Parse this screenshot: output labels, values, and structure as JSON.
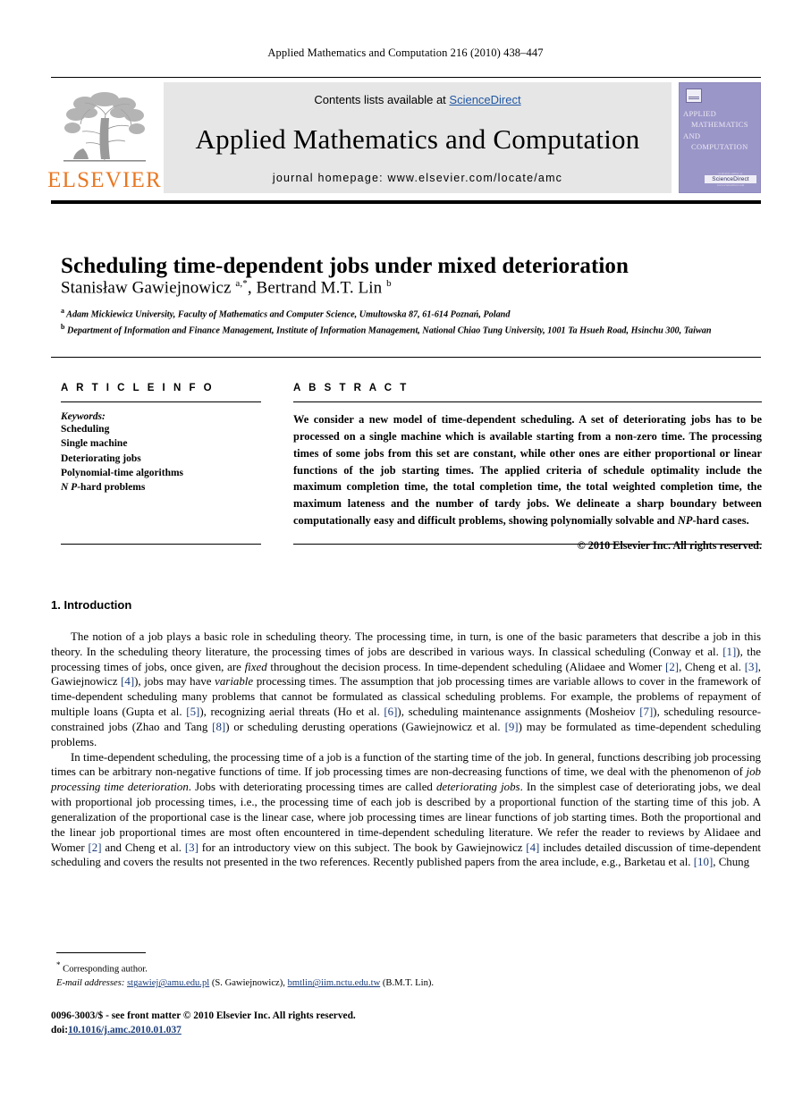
{
  "running_head": "Applied Mathematics and Computation 216 (2010) 438–447",
  "masthead": {
    "publisher_name": "ELSEVIER",
    "contents_prefix": "Contents lists available at ",
    "contents_link": "ScienceDirect",
    "journal_title": "Applied Mathematics and Computation",
    "homepage_line": "journal homepage: www.elsevier.com/locate/amc",
    "cover": {
      "line1": "APPLIED",
      "line2": "MATHEMATICS",
      "line3": "AND",
      "line4": "COMPUTATION",
      "badge_top": "available online at",
      "badge_mid": "ScienceDirect",
      "badge_bottom": "www.sciencedirect.com"
    }
  },
  "article": {
    "title": "Scheduling time-dependent jobs under mixed deterioration",
    "authors": "Stanisław Gawiejnowicz <sup>a,*</sup>, Bertrand M.T. Lin <sup>b</sup>",
    "affiliation_a": "<sup>a</sup> Adam Mickiewicz University, Faculty of Mathematics and Computer Science, Umultowska 87, 61-614 Poznań, Poland",
    "affiliation_b": "<sup>b</sup> Department of Information and Finance Management, Institute of Information Management, National Chiao Tung University, 1001 Ta Hsueh Road, Hsinchu 300, Taiwan"
  },
  "article_info": {
    "heading": "A R T I C L E   I N F O",
    "keywords_label": "Keywords:",
    "keywords": [
      "Scheduling",
      "Single machine",
      "Deteriorating jobs",
      "Polynomial-time algorithms",
      "NP-hard problems"
    ]
  },
  "abstract": {
    "heading": "A B S T R A C T",
    "text": "We consider a new model of time-dependent scheduling. A set of deteriorating jobs has to be processed on a single machine which is available starting from a non-zero time. The processing times of some jobs from this set are constant, while other ones are either proportional or linear functions of the job starting times. The applied criteria of schedule optimality include the maximum completion time, the total completion time, the total weighted completion time, the maximum lateness and the number of tardy jobs. We delineate a sharp boundary between computationally easy and difficult problems, showing polynomially solvable and <span class=\"np\">NP</span>-hard cases.",
    "copyright": "© 2010 Elsevier Inc. All rights reserved."
  },
  "introduction": {
    "heading": "1. Introduction",
    "paragraph1": "The notion of a job plays a basic role in scheduling theory. The processing time, in turn, is one of the basic parameters that describe a job in this theory. In the scheduling theory literature, the processing times of jobs are described in various ways. In classical scheduling (Conway et al. <span class=\"ref\">[1]</span>), the processing times of jobs, once given, are <span class=\"it\">fixed</span> throughout the decision process. In time-dependent scheduling (Alidaee and Womer <span class=\"ref\">[2]</span>, Cheng et al. <span class=\"ref\">[3]</span>, Gawiejnowicz <span class=\"ref\">[4]</span>), jobs may have <span class=\"it\">variable</span> processing times. The assumption that job processing times are variable allows to cover in the framework of time-dependent scheduling many problems that cannot be formulated as classical scheduling problems. For example, the problems of repayment of multiple loans (Gupta et al. <span class=\"ref\">[5]</span>), recognizing aerial threats (Ho et al. <span class=\"ref\">[6]</span>), scheduling maintenance assignments (Mosheiov <span class=\"ref\">[7]</span>), scheduling resource-constrained jobs (Zhao and Tang <span class=\"ref\">[8]</span>) or scheduling derusting operations (Gawiejnowicz et al. <span class=\"ref\">[9]</span>) may be formulated as time-dependent scheduling problems.",
    "paragraph2": "In time-dependent scheduling, the processing time of a job is a function of the starting time of the job. In general, functions describing job processing times can be arbitrary non-negative functions of time. If job processing times are non-decreasing functions of time, we deal with the phenomenon of <span class=\"it\">job processing time deterioration</span>. Jobs with deteriorating processing times are called <span class=\"it\">deteriorating jobs</span>. In the simplest case of deteriorating jobs, we deal with proportional job processing times, i.e., the processing time of each job is described by a proportional function of the starting time of this job. A generalization of the proportional case is the linear case, where job processing times are linear functions of job starting times. Both the proportional and the linear job proportional times are most often encountered in time-dependent scheduling literature. We refer the reader to reviews by Alidaee and Womer <span class=\"ref\">[2]</span> and Cheng et al. <span class=\"ref\">[3]</span> for an introductory view on this subject. The book by Gawiejnowicz <span class=\"ref\">[4]</span> includes detailed discussion of time-dependent scheduling and covers the results not presented in the two references. Recently published papers from the area include, e.g., Barketau et al. <span class=\"ref\">[10]</span>, Chung"
  },
  "footnote": {
    "corresponding": "Corresponding author.",
    "email_label": "E-mail addresses:",
    "email1": "stgawiej@amu.edu.pl",
    "email1_owner": "(S. Gawiejnowicz),",
    "email2": "bmtlin@iim.nctu.edu.tw",
    "email2_owner": "(B.M.T. Lin)."
  },
  "footer": {
    "issn_line": "0096-3003/$ - see front matter © 2010 Elsevier Inc. All rights reserved.",
    "doi_label": "doi:",
    "doi_value": "10.1016/j.amc.2010.01.037"
  },
  "colors": {
    "elsevier_orange": "#E87722",
    "link_blue": "#1F57A4",
    "ref_blue": "#1a3c7a",
    "banner_gray": "#e6e6e6",
    "cover_purple": "#9b96c8"
  }
}
